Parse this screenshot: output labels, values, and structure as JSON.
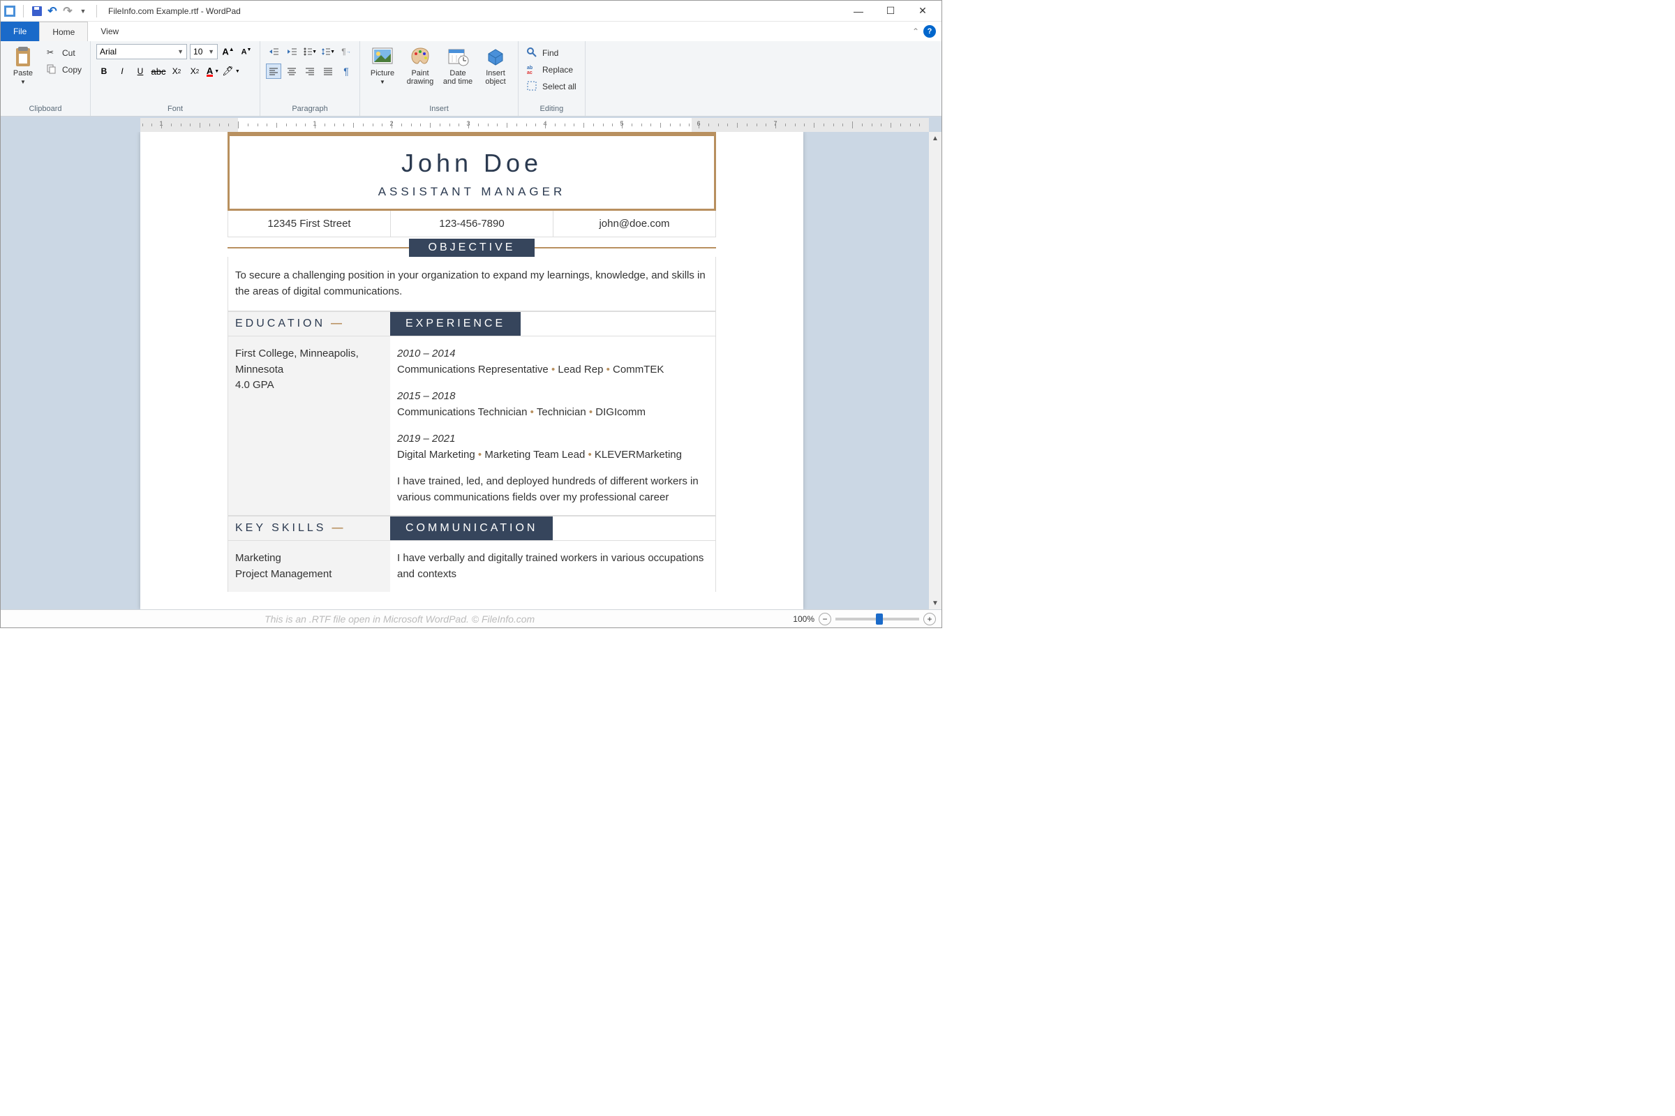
{
  "app": {
    "title": "FileInfo.com Example.rtf - WordPad",
    "tabs": {
      "file": "File",
      "home": "Home",
      "view": "View"
    }
  },
  "ribbon": {
    "clipboard": {
      "paste": "Paste",
      "cut": "Cut",
      "copy": "Copy",
      "label": "Clipboard"
    },
    "font": {
      "name": "Arial",
      "size": "10",
      "label": "Font"
    },
    "paragraph": {
      "label": "Paragraph"
    },
    "insert": {
      "picture": "Picture",
      "paint": "Paint drawing",
      "datetime": "Date and time",
      "object": "Insert object",
      "label": "Insert"
    },
    "editing": {
      "find": "Find",
      "replace": "Replace",
      "selectall": "Select all",
      "label": "Editing"
    }
  },
  "ruler": {
    "marks": [
      1,
      2,
      3,
      4,
      5,
      6,
      7
    ]
  },
  "resume": {
    "name": "John Doe",
    "title": "ASSISTANT MANAGER",
    "contact": {
      "address": "12345 First Street",
      "phone": "123-456-7890",
      "email": "john@doe.com"
    },
    "objective_label": "OBJECTIVE",
    "objective": "To secure a challenging position in your organization to expand my learnings, knowledge, and skills in the areas of digital communications.",
    "education_label": "EDUCATION",
    "experience_label": "EXPERIENCE",
    "education": {
      "school": "First College, Minneapolis, Minnesota",
      "gpa": "4.0 GPA"
    },
    "exp": [
      {
        "dates": "2010 – 2014",
        "role": "Communications Representative",
        "mid": "Lead Rep",
        "company": "CommTEK"
      },
      {
        "dates": "2015 – 2018",
        "role": "Communications Technician",
        "mid": "Technician",
        "company": "DIGIcomm"
      },
      {
        "dates": "2019 – 2021",
        "role": "Digital Marketing",
        "mid": "Marketing Team Lead",
        "company": "KLEVERMarketing"
      }
    ],
    "exp_summary": "I have trained, led, and deployed hundreds of different workers in various communications fields over my professional career",
    "skills_label": "KEY SKILLS",
    "communication_label": "COMMUNICATION",
    "skills": [
      "Marketing",
      "Project Management"
    ],
    "communication": "I have verbally and digitally trained workers in various occupations and contexts"
  },
  "status": {
    "watermark": "This is an .RTF file open in Microsoft WordPad. © FileInfo.com",
    "zoom": "100%"
  }
}
